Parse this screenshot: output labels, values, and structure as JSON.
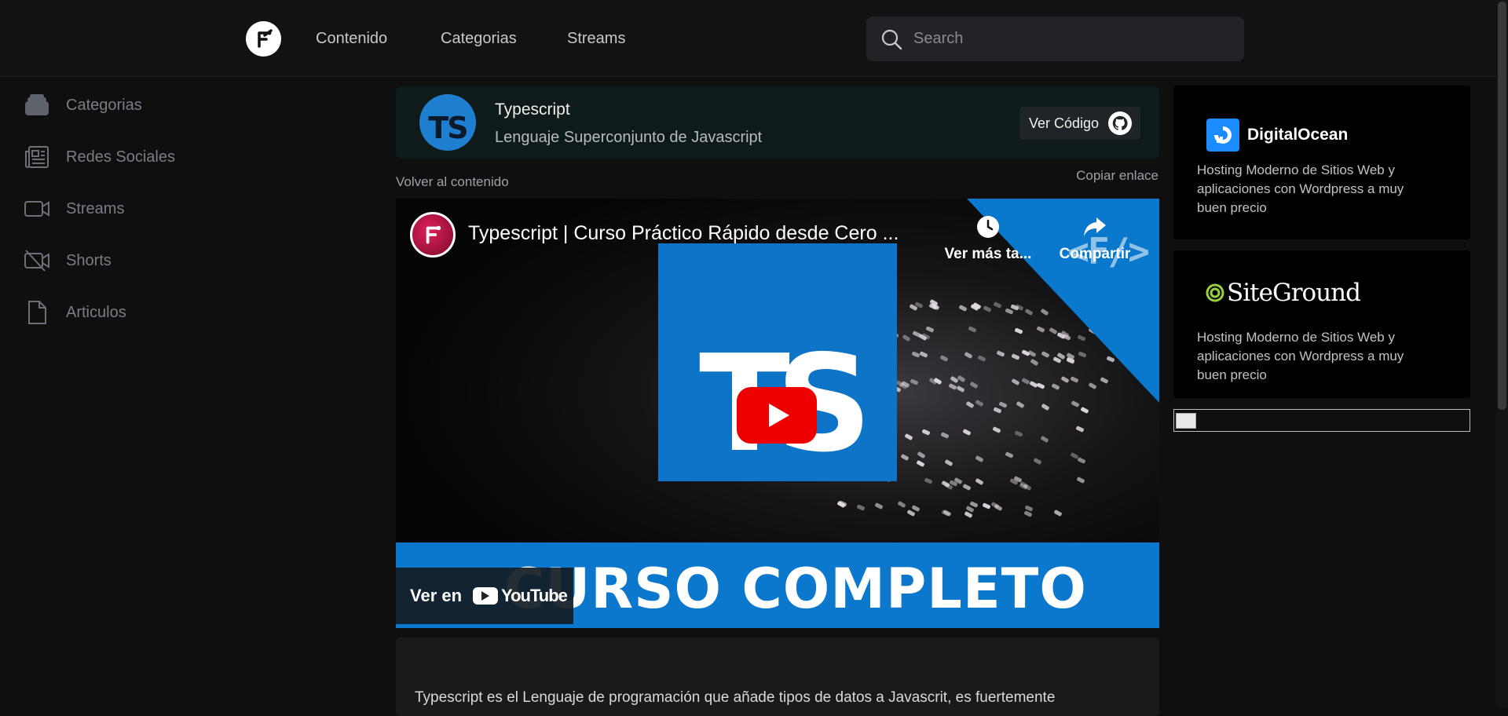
{
  "nav": {
    "links": [
      "Contenido",
      "Categorias",
      "Streams"
    ],
    "search_placeholder": "Search"
  },
  "sidebar": {
    "items": [
      {
        "label": "Categorias",
        "icon": "layers-icon"
      },
      {
        "label": "Redes Sociales",
        "icon": "newspaper-icon"
      },
      {
        "label": "Streams",
        "icon": "video-camera-icon"
      },
      {
        "label": "Shorts",
        "icon": "video-off-icon"
      },
      {
        "label": "Articulos",
        "icon": "document-icon"
      }
    ]
  },
  "content": {
    "avatar_text": "TS",
    "title": "Typescript",
    "subtitle": "Lenguaje Superconjunto de Javascript",
    "code_button": "Ver Código",
    "back_link": "Volver al contenido",
    "copy_link": "Copiar enlace",
    "video": {
      "title": "Typescript | Curso Práctico Rápido desde Cero ...",
      "watch_later": "Ver más ta...",
      "share": "Compartir",
      "thumb_letters": "TS",
      "banner": "CURSO COMPLETO",
      "watch_on": "Ver en",
      "youtube": "YouTube"
    },
    "description": "Typescript es el Lenguaje de programación que añade tipos de datos a Javascrit, es fuertemente"
  },
  "ads": [
    {
      "brand": "DigitalOcean",
      "text": "Hosting Moderno de Sitios Web y aplicaciones con Wordpress a muy buen precio"
    },
    {
      "brand": "SiteGround",
      "text": "Hosting Moderno de Sitios Web y aplicaciones con Wordpress a muy buen precio"
    }
  ],
  "colors": {
    "accent_blue": "#0b78cd",
    "youtube_red": "#ee0000",
    "background": "#0f0f10"
  }
}
